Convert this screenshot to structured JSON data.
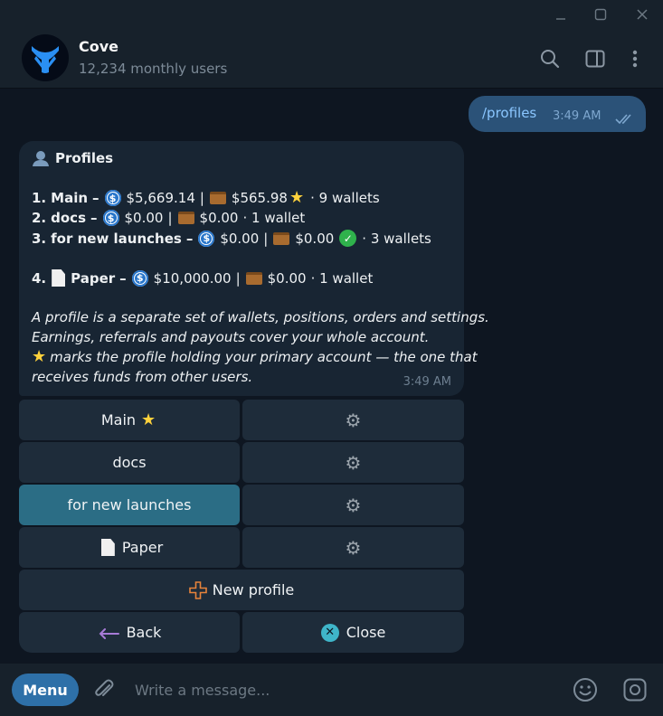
{
  "window": {
    "minimize_icon": "minimize-icon",
    "maximize_icon": "maximize-icon",
    "close_icon": "close-icon"
  },
  "header": {
    "title": "Cove",
    "subtitle": "12,234 monthly users",
    "icons": [
      "search-icon",
      "sidebar-toggle-icon",
      "more-vert-icon"
    ]
  },
  "outgoing": {
    "text": "/profiles",
    "time": "3:49 AM",
    "status": "read"
  },
  "incoming": {
    "heading": "Profiles",
    "profiles": [
      {
        "num": "1.",
        "name": "Main",
        "dash": "–",
        "balance": "$5,669.14",
        "sep": "|",
        "positions": "$565.98",
        "marker": "star",
        "wallets": "· 9 wallets"
      },
      {
        "num": "2.",
        "name": "docs",
        "dash": "–",
        "balance": "$0.00",
        "sep": "|",
        "positions": "$0.00",
        "wallets": "· 1 wallet"
      },
      {
        "num": "3.",
        "name": "for new launches",
        "dash": "–",
        "balance": "$0.00",
        "sep": "|",
        "positions": "$0.00",
        "marker": "check",
        "wallets": "· 3 wallets"
      },
      {
        "num": "4.",
        "name": "Paper",
        "dash": "–",
        "balance": "$10,000.00",
        "sep": "|",
        "positions": "$0.00",
        "wallets": "· 1 wallet"
      }
    ],
    "note_lines": [
      "A profile is a separate set of wallets, positions, orders and settings.",
      "Earnings, referrals and payouts cover your whole account.",
      "marks the profile holding your primary account — the one that",
      "receives funds from other users."
    ],
    "time": "3:49 AM"
  },
  "keyboard": {
    "rows": [
      {
        "label": "Main",
        "settings": "gear-icon"
      },
      {
        "label": "docs",
        "settings": "gear-icon"
      },
      {
        "label": "for new launches",
        "settings": "gear-icon",
        "active": true
      },
      {
        "label": "Paper",
        "settings": "gear-icon"
      }
    ],
    "new_profile": "New profile",
    "back": "Back",
    "close": "Close"
  },
  "composer": {
    "menu": "Menu",
    "placeholder": "Write a message..."
  },
  "colors": {
    "accent": "#2e70a8",
    "bubble_out": "#2b5278",
    "bubble_in": "#182533",
    "active_button": "#2b6d85"
  }
}
